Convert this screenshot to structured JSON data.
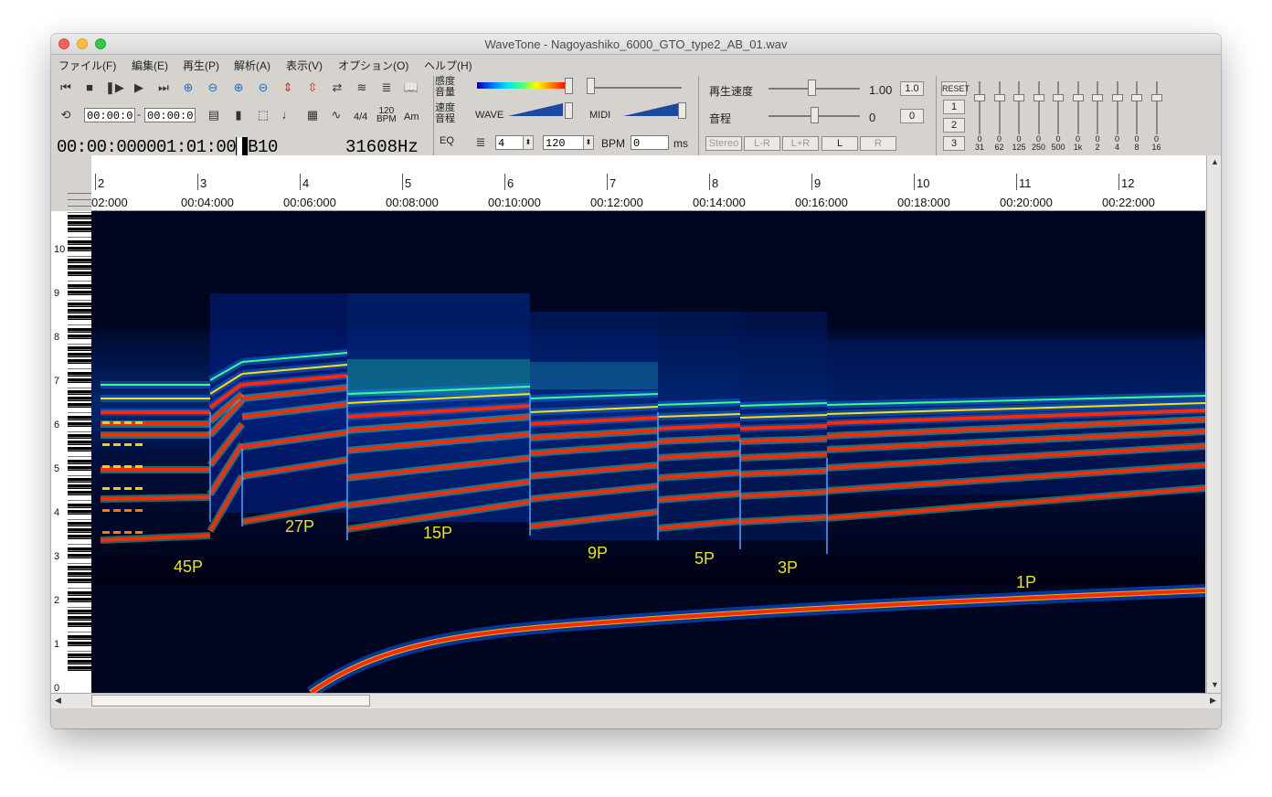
{
  "window": {
    "title": "WaveTone - Nagoyashiko_6000_GTO_type2_AB_01.wav"
  },
  "menu": [
    {
      "label": "ファイル(F)"
    },
    {
      "label": "編集(E)"
    },
    {
      "label": "再生(P)"
    },
    {
      "label": "解析(A)"
    },
    {
      "label": "表示(V)"
    },
    {
      "label": "オプション(O)"
    },
    {
      "label": "ヘルプ(H)"
    }
  ],
  "toolbar": {
    "range_start": "00:00:0",
    "range_end": "00:00:0",
    "time_sig": "4/4",
    "bpm_icon_top": "120",
    "bpm_icon_bottom": "BPM",
    "chord_icon": "Am",
    "time_display": "00:00:000001:01:00",
    "note_display": "B10",
    "hz_display": "31608Hz",
    "eq_label": "EQ",
    "beats_value": "4",
    "tempo_value": "120",
    "bpm_label": "BPM",
    "offset_value": "0",
    "ms_label": "ms",
    "sensitivity_label_1": "感度",
    "sensitivity_label_2": "音量",
    "speed_label_1": "速度",
    "speed_label_2": "音程",
    "wave_label": "WAVE",
    "midi_label": "MIDI",
    "playback_speed_label": "再生速度",
    "playback_speed_value": "1.00",
    "playback_speed_reset": "1.0",
    "pitch_label": "音程",
    "pitch_value": "0",
    "pitch_reset": "0",
    "channel_buttons": [
      "Stereo",
      "L-R",
      "L+R",
      "L",
      "R"
    ],
    "reset_label": "RESET",
    "preset_buttons": [
      "1",
      "2",
      "3"
    ],
    "eq_bands": [
      "31",
      "62",
      "125",
      "250",
      "500",
      "1k",
      "2",
      "4",
      "8",
      "16"
    ],
    "eq_values": [
      "0",
      "0",
      "0",
      "0",
      "0",
      "0",
      "0",
      "0",
      "0",
      "0"
    ]
  },
  "ruler": {
    "bars": [
      "2",
      "3",
      "4",
      "5",
      "6",
      "7",
      "8",
      "9",
      "10",
      "11",
      "12"
    ],
    "times": [
      "02:000",
      "00:04:000",
      "00:06:000",
      "00:08:000",
      "00:10:000",
      "00:12:000",
      "00:14:000",
      "00:16:000",
      "00:18:000",
      "00:20:000",
      "00:22:000"
    ]
  },
  "keyboard": {
    "octaves": [
      "10",
      "9",
      "8",
      "7",
      "6",
      "5",
      "4",
      "3",
      "2",
      "1",
      "0"
    ]
  },
  "spectrogram": {
    "annotations": [
      "45P",
      "27P",
      "15P",
      "9P",
      "5P",
      "3P",
      "1P"
    ]
  }
}
